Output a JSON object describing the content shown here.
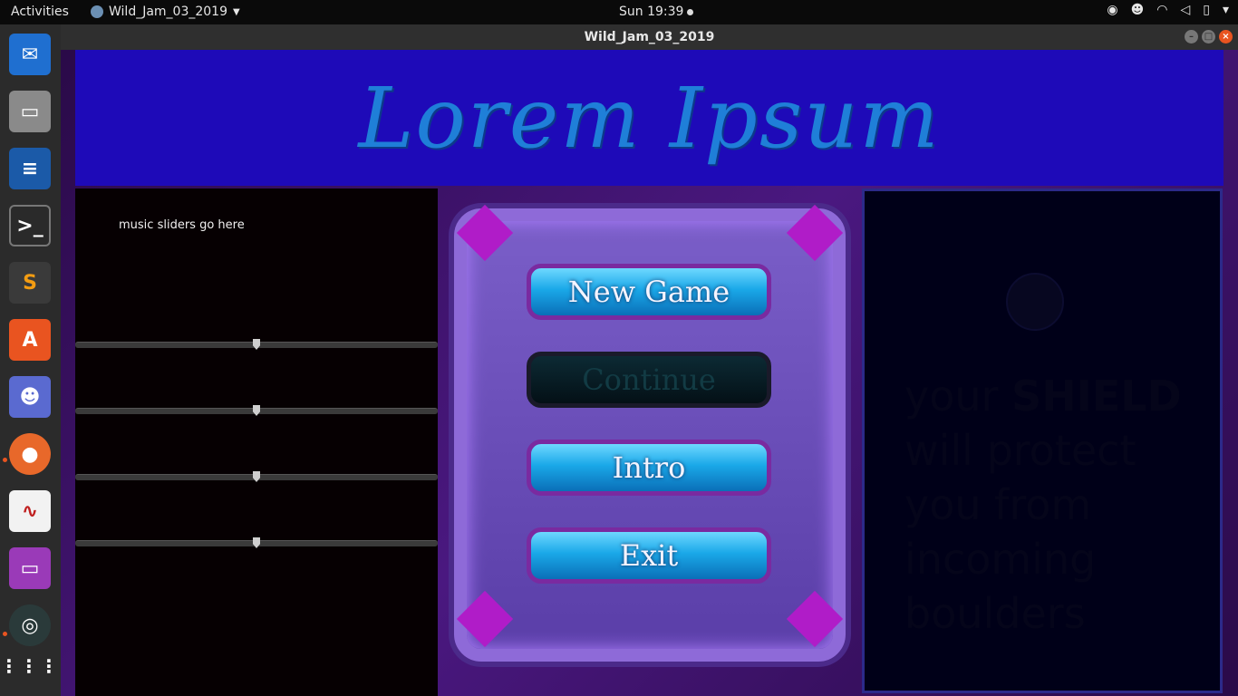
{
  "topbar": {
    "activities": "Activities",
    "app_name": "Wild_Jam_03_2019",
    "clock": "Sun 19:39",
    "tray_icons": [
      "steam-icon",
      "discord-icon",
      "wifi-icon",
      "volume-icon",
      "battery-icon",
      "power-menu-icon"
    ]
  },
  "dock": {
    "apps": [
      "thunderbird",
      "files",
      "libreoffice-writer",
      "terminal",
      "sublime-text",
      "software-center",
      "discord",
      "firefox",
      "document-viewer",
      "window-app",
      "obs",
      "show-applications"
    ]
  },
  "window": {
    "title": "Wild_Jam_03_2019"
  },
  "game": {
    "header_title": "Lorem Ipsum",
    "left_note": "music sliders go here",
    "sliders": [
      0.5,
      0.5,
      0.5,
      0.5
    ],
    "menu": {
      "new_game": "New Game",
      "continue": "Continue",
      "intro": "Intro",
      "exit": "Exit"
    },
    "hint": {
      "line1_a": "your",
      "line1_b": "SHIELD",
      "line2": "will protect",
      "line3": "you from",
      "line4": "incoming",
      "line5": "boulders"
    }
  },
  "colors": {
    "header_bg": "#1e0ab8",
    "title_color": "#1f7fd8",
    "button_cyan": "#1aa8e8",
    "frame_purple": "#8e6ad8"
  }
}
